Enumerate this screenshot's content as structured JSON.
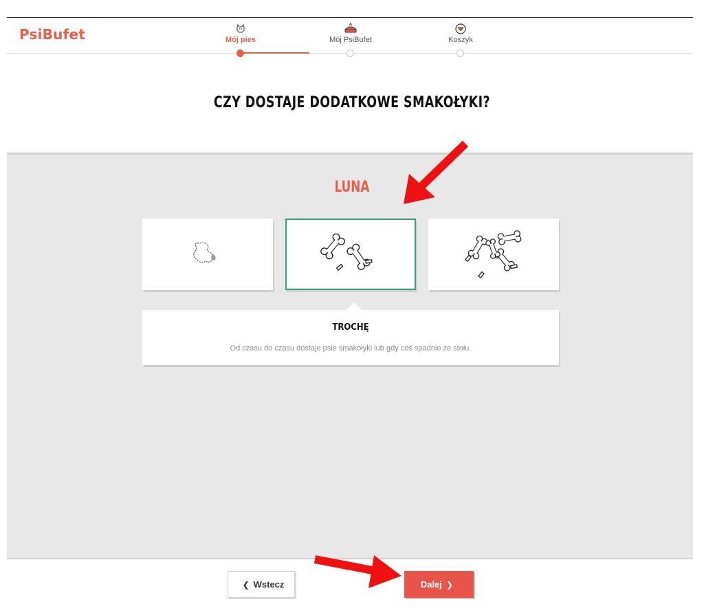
{
  "brand": {
    "name": "PsiBufet",
    "accent_color": "#e85f4b"
  },
  "steps": [
    {
      "label": "Mój pies",
      "icon": "dog-icon",
      "active": true
    },
    {
      "label": "Mój PsiBufet",
      "icon": "bowl-icon",
      "active": false
    },
    {
      "label": "Koszyk",
      "icon": "cart-icon",
      "active": false
    }
  ],
  "question": "CZY DOSTAJE DODATKOWE SMAKOŁYKI?",
  "dog_name": "LUNA",
  "options": [
    {
      "icon": "one-bone-icon",
      "selected": false
    },
    {
      "icon": "few-bones-icon",
      "selected": true
    },
    {
      "icon": "many-bones-icon",
      "selected": false
    }
  ],
  "selected_option": {
    "title": "TROCHĘ",
    "description": "Od czasu do czasu dostaje psie smakołyki lub gdy coś spadnie ze stołu."
  },
  "buttons": {
    "back": "Wstecz",
    "next": "Dalej"
  },
  "annotations": {
    "arrow_color": "#ee1111"
  }
}
